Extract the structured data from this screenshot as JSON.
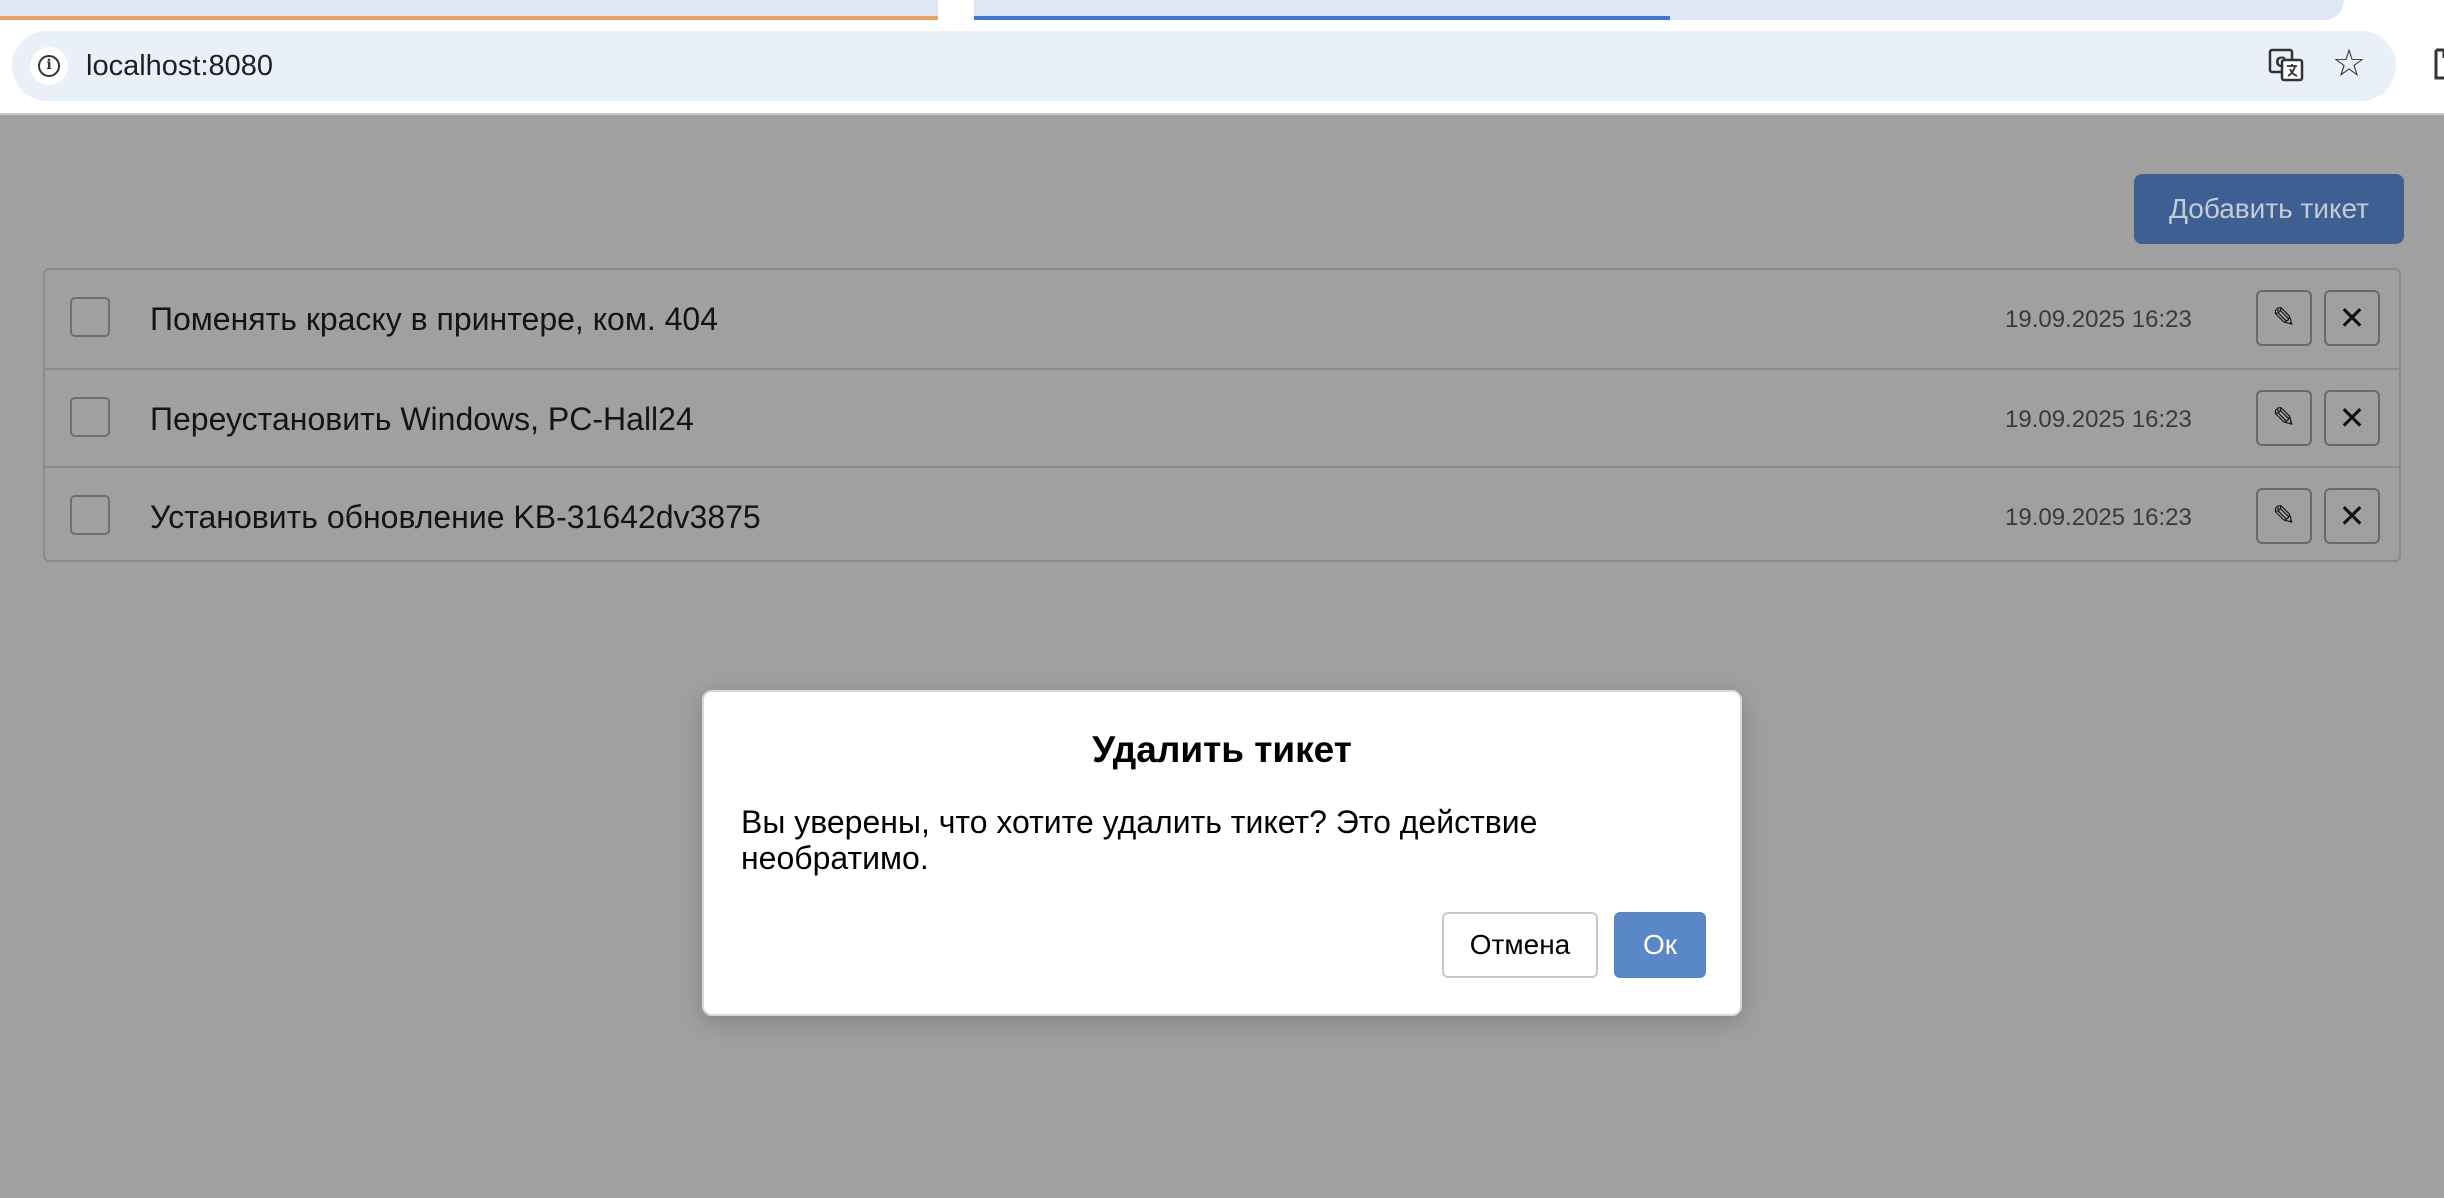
{
  "browser": {
    "url": "localhost:8080",
    "icons": [
      "info-icon",
      "translate-icon",
      "star-icon",
      "extensions-icon"
    ]
  },
  "toolbar": {
    "add_ticket_label": "Добавить тикет"
  },
  "tickets": [
    {
      "title": "Поменять краску в принтере, ком. 404",
      "date": "19.09.2025 16:23",
      "checked": false
    },
    {
      "title": "Переустановить Windows, PC-Hall24",
      "date": "19.09.2025 16:23",
      "checked": false
    },
    {
      "title": "Установить обновление KB-31642dv3875",
      "date": "19.09.2025 16:23",
      "checked": false
    }
  ],
  "ticket_actions": {
    "edit_icon": "pencil-icon",
    "delete_icon": "close-icon"
  },
  "modal": {
    "title": "Удалить тикет",
    "message": "Вы уверены, что хотите удалить тикет? Это действие необратимо.",
    "cancel_label": "Отмена",
    "ok_label": "Ок"
  },
  "colors": {
    "overlay_background": "#a0a0a0",
    "primary_button": "#5a87c6",
    "primary_button_dimmed": "#3d5f91",
    "tab_accent_orange": "#e8a063",
    "tab_accent_blue": "#3d78d8"
  }
}
